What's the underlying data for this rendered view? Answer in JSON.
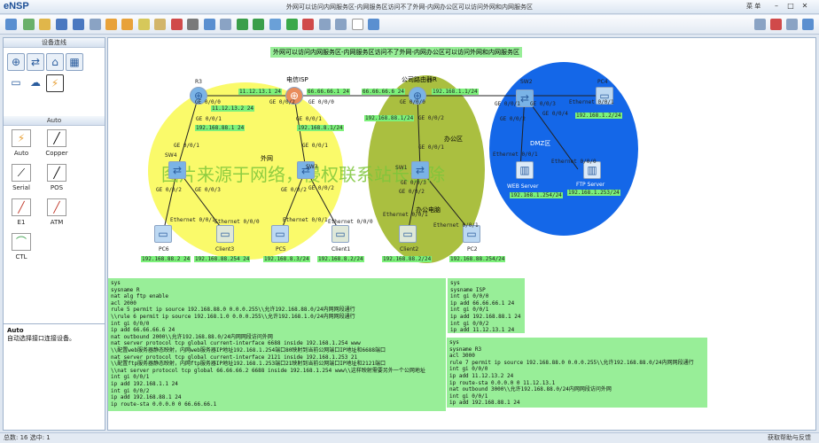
{
  "app": {
    "name": "eNSP",
    "window_title": "外网可以访问内网服务区-内网服务区访问不了外网-内网办公区可以访问外网和内网服务区",
    "menu": "菜 单"
  },
  "left_panel": {
    "title": "设备连线",
    "section": "Auto",
    "cables": [
      {
        "label": "Auto",
        "icon": "auto-cable-icon",
        "glyph": "⚡"
      },
      {
        "label": "Copper",
        "icon": "copper-cable-icon",
        "glyph": "╱"
      },
      {
        "label": "Serial",
        "icon": "serial-cable-icon",
        "glyph": "⟋"
      },
      {
        "label": "POS",
        "icon": "pos-cable-icon",
        "glyph": "╱"
      },
      {
        "label": "E1",
        "icon": "e1-cable-icon",
        "glyph": "╱"
      },
      {
        "label": "ATM",
        "icon": "atm-cable-icon",
        "glyph": "╱"
      },
      {
        "label": "CTL",
        "icon": "ctl-cable-icon",
        "glyph": "⌒"
      }
    ],
    "desc_title": "Auto",
    "desc_text": "自动选择接口连接设备。"
  },
  "status": {
    "left": "总数: 16  选中: 1",
    "right": "获取帮助与反馈"
  },
  "canvas": {
    "banner": "外网可以访问内网服务区-内网服务区访问不了外网-内网办公区可以访问外网和内网服务区",
    "watermark": "图片来源于网络，侵权联系站长删除",
    "zones": {
      "isp": "电信ISP",
      "pub": "公司路由器R",
      "outer": "外网",
      "office": "办公区",
      "dmz": "DMZ区",
      "office_pc": "办公电脑"
    },
    "devices": {
      "R3": "R3",
      "SW4": "SW4",
      "SW3": "SW3",
      "PC6": "PC6",
      "Client3": "Client3",
      "PC5": "PC5",
      "Client1": "Client1",
      "SW1": "SW1",
      "Client2": "Client2",
      "PC2": "PC2",
      "SW2": "SW2",
      "PC4": "PC4",
      "WEB": "WEB Server",
      "FTP": "FTP Server"
    },
    "ips": {
      "a": "11.12.13.1 24",
      "b": "66.66.66.1 24",
      "c": "66.66.66.6 24",
      "d": "192.168.1.1/24",
      "e": "11.12.13.2 24",
      "f": "192.168.88.1 24",
      "g": "192.168.8.1/24",
      "h": "192.168.88.1/24",
      "i": "192.168.1.2/24",
      "j": "192.168.88.2 24",
      "k": "192.168.88.254 24",
      "l": "192.168.8.3/24",
      "m": "192.168.8.2/24",
      "n": "192.168.88.2/24",
      "o": "192.168.88.254/24",
      "p": "192.168.1.254/24",
      "q": "192.168.1.253/24"
    },
    "ports": [
      "GE 0/0/0",
      "GE 0/0/1",
      "GE 0/0/2",
      "GE 0/0/3",
      "GE 0/0/4",
      "Ethernet 0/0/1",
      "Ethernet 0/0/0"
    ],
    "config_r": "sys\nsysname R\nnat alg ftp enable\nacl 2000\nrule 5 permit ip source 192.168.88.0 0.0.0.255\\\\允许192.168.88.0/24内网网段通行\n\\\\rule 6 permit ip source 192.168.1.0 0.0.0.255\\\\允许192.168.1.0/24内网网段通行\nint gi 0/0/0\nip add 66.66.66.6 24\nnat outbound 2000\\\\允许192.168.88.0/24内网网段访问外网\nnat server protocol tcp global current-interface 6688 inside 192.168.1.254 www\n\\\\配置web服务器静态映射，内网web服务器IP地址192.168.1.254端口80映射到当前公网端口IP地址和6688端口\nnat server protocol tcp global current-interface 2121 inside 192.168.1.253 21\n\\\\配置ftp服务器静态映射，内网ftp服务器IP地址192.168.1.253端口21映射到当前公网端口IP地址和2121端口\n\\\\nat server protocol tcp global 66.66.66.2 6688 inside 192.168.1.254 www\\\\这样映射需要另外一个公网地址\nint gi 0/0/1\nip add 192.168.1.1 24\nint gi 0/0/2\nip add 192.168.88.1 24\nip route-sta 0.0.0.0 0 66.66.66.1",
    "config_isp": "sys\nsysname ISP\nint gi 0/0/0\nip add 66.66.66.1 24\nint gi 0/0/1\nip add 192.168.88.1 24\nint gi 0/0/2\nip add 11.12.13.1 24",
    "config_r3": "sys\nsysname R3\nacl 3000\nrule 7 permit ip source 192.168.88.0 0.0.0.255\\\\允许192.168.88.0/24内网网段通行\nint gi 0/0/0\nip add 11.12.13.2 24\nip route-sta 0.0.0.0 0 11.12.13.1\nnat outbound 3000\\\\允许192.168.88.0/24内网网段访问外网\nint gi 0/0/1\nip add 192.168.88.1 24"
  }
}
